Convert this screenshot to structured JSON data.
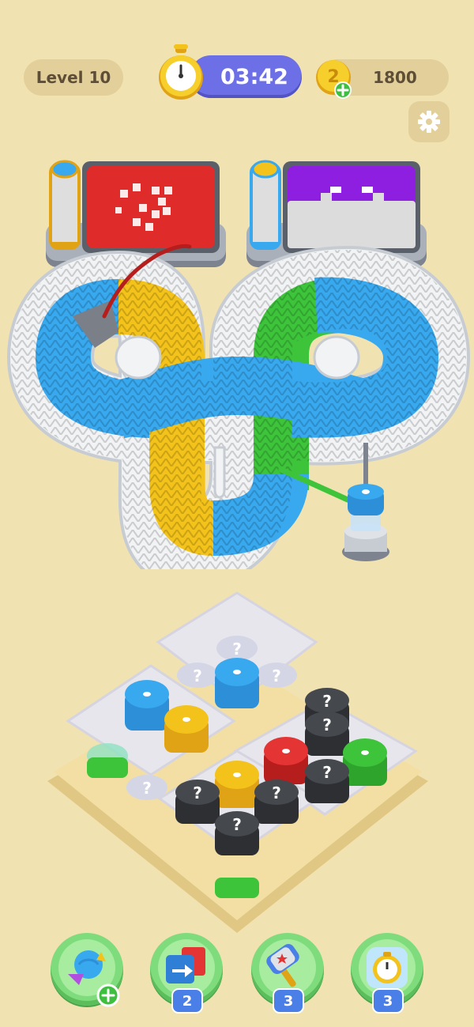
{
  "hud": {
    "level_label": "Level 10",
    "timer_text": "03:42",
    "coins_text": "1800"
  },
  "boosters": [
    {
      "name": "yarn-swap",
      "badge": ""
    },
    {
      "name": "shuffle",
      "badge": "2"
    },
    {
      "name": "hammer",
      "badge": "3"
    },
    {
      "name": "freeze-timer",
      "badge": "3"
    }
  ],
  "icons": {
    "timer": "stopwatch-icon",
    "coin": "coin-icon",
    "settings": "gear-icon"
  },
  "colors": {
    "background": "#f1e2b1",
    "timer_bg": "#6c6fe6",
    "yarn_blue": "#38a8ef",
    "yarn_yellow": "#f3c21b",
    "yarn_green": "#3dc43a",
    "yarn_red": "#e53434",
    "yarn_purple": "#8f1fe0",
    "booster_green": "#7fdc7c",
    "badge_blue": "#4b7fe8"
  }
}
